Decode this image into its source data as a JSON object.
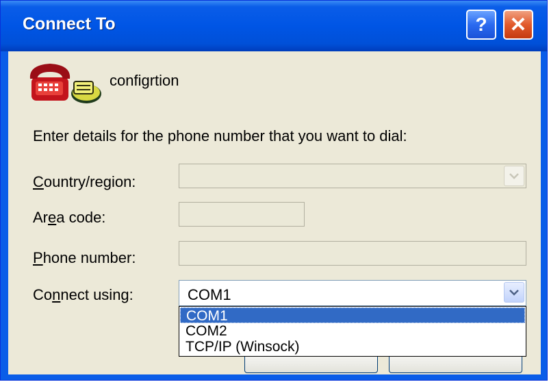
{
  "window": {
    "title": "Connect To",
    "help_glyph": "?",
    "close_glyph": "✕"
  },
  "connection": {
    "name": "configrtion",
    "icon": "phone-icon"
  },
  "instructions": "Enter details for the phone number that you want to dial:",
  "fields": {
    "country_label_hotkey": "C",
    "country_label_rest": "ountry/region:",
    "country_value": "",
    "area_label_pre": "Ar",
    "area_label_hotkey": "e",
    "area_label_post": "a code:",
    "area_value": "",
    "phone_label_hotkey": "P",
    "phone_label_rest": "hone number:",
    "phone_value": "",
    "connect_label_pre": "Co",
    "connect_label_hotkey": "n",
    "connect_label_post": "nect using:",
    "connect_value": "COM1"
  },
  "dropdown_options": [
    "COM1",
    "COM2",
    "TCP/IP (Winsock)"
  ],
  "colors": {
    "titlebar": "#0055e5",
    "selection": "#316ac5",
    "dialog_bg": "#ece9d8"
  }
}
